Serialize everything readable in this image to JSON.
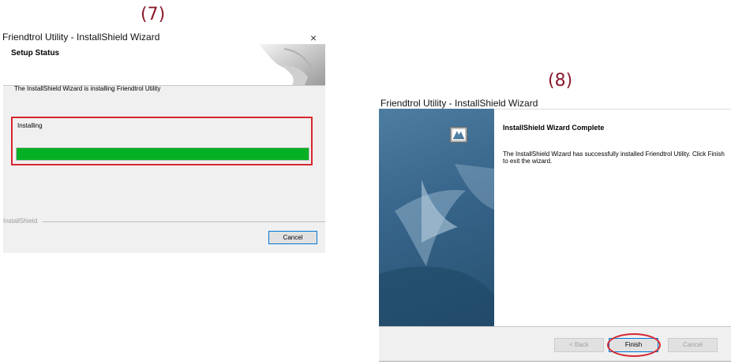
{
  "steps": {
    "step7_label": "(7)",
    "step8_label": "(8)"
  },
  "dialog7": {
    "window_title": "Friendtrol Utility - InstallShield Wizard",
    "close_glyph": "×",
    "header_title": "Setup Status",
    "message": "The InstallShield Wizard is installing Friendtrol Utility",
    "status_text": "Installing",
    "progress_fraction": 1.0,
    "brand_text": "InstallShield",
    "cancel_label": "Cancel",
    "colors": {
      "progress": "#06b025",
      "highlight": "#d7262e"
    }
  },
  "dialog8": {
    "window_title": "Friendtrol Utility - InstallShield Wizard",
    "heading": "InstallShield Wizard Complete",
    "body_text": "The InstallShield Wizard has successfully installed Friendtrol Utility.  Click Finish to exit the wizard.",
    "back_label": "< Back",
    "finish_label": "Finish",
    "cancel_label": "Cancel",
    "icons": {
      "wizard": "installshield-wizard-icon",
      "side_art": "sail-graphic"
    }
  }
}
